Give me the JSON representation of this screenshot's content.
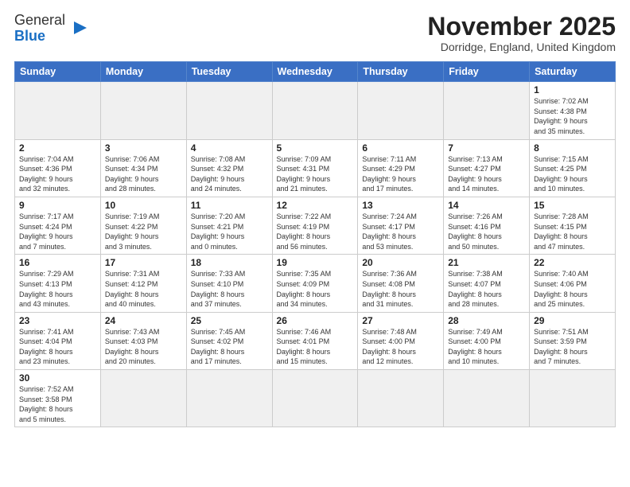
{
  "logo": {
    "line1": "General",
    "line2": "Blue"
  },
  "title": "November 2025",
  "location": "Dorridge, England, United Kingdom",
  "weekdays": [
    "Sunday",
    "Monday",
    "Tuesday",
    "Wednesday",
    "Thursday",
    "Friday",
    "Saturday"
  ],
  "weeks": [
    [
      {
        "day": "",
        "info": ""
      },
      {
        "day": "",
        "info": ""
      },
      {
        "day": "",
        "info": ""
      },
      {
        "day": "",
        "info": ""
      },
      {
        "day": "",
        "info": ""
      },
      {
        "day": "",
        "info": ""
      },
      {
        "day": "1",
        "info": "Sunrise: 7:02 AM\nSunset: 4:38 PM\nDaylight: 9 hours\nand 35 minutes."
      }
    ],
    [
      {
        "day": "2",
        "info": "Sunrise: 7:04 AM\nSunset: 4:36 PM\nDaylight: 9 hours\nand 32 minutes."
      },
      {
        "day": "3",
        "info": "Sunrise: 7:06 AM\nSunset: 4:34 PM\nDaylight: 9 hours\nand 28 minutes."
      },
      {
        "day": "4",
        "info": "Sunrise: 7:08 AM\nSunset: 4:32 PM\nDaylight: 9 hours\nand 24 minutes."
      },
      {
        "day": "5",
        "info": "Sunrise: 7:09 AM\nSunset: 4:31 PM\nDaylight: 9 hours\nand 21 minutes."
      },
      {
        "day": "6",
        "info": "Sunrise: 7:11 AM\nSunset: 4:29 PM\nDaylight: 9 hours\nand 17 minutes."
      },
      {
        "day": "7",
        "info": "Sunrise: 7:13 AM\nSunset: 4:27 PM\nDaylight: 9 hours\nand 14 minutes."
      },
      {
        "day": "8",
        "info": "Sunrise: 7:15 AM\nSunset: 4:25 PM\nDaylight: 9 hours\nand 10 minutes."
      }
    ],
    [
      {
        "day": "9",
        "info": "Sunrise: 7:17 AM\nSunset: 4:24 PM\nDaylight: 9 hours\nand 7 minutes."
      },
      {
        "day": "10",
        "info": "Sunrise: 7:19 AM\nSunset: 4:22 PM\nDaylight: 9 hours\nand 3 minutes."
      },
      {
        "day": "11",
        "info": "Sunrise: 7:20 AM\nSunset: 4:21 PM\nDaylight: 9 hours\nand 0 minutes."
      },
      {
        "day": "12",
        "info": "Sunrise: 7:22 AM\nSunset: 4:19 PM\nDaylight: 8 hours\nand 56 minutes."
      },
      {
        "day": "13",
        "info": "Sunrise: 7:24 AM\nSunset: 4:17 PM\nDaylight: 8 hours\nand 53 minutes."
      },
      {
        "day": "14",
        "info": "Sunrise: 7:26 AM\nSunset: 4:16 PM\nDaylight: 8 hours\nand 50 minutes."
      },
      {
        "day": "15",
        "info": "Sunrise: 7:28 AM\nSunset: 4:15 PM\nDaylight: 8 hours\nand 47 minutes."
      }
    ],
    [
      {
        "day": "16",
        "info": "Sunrise: 7:29 AM\nSunset: 4:13 PM\nDaylight: 8 hours\nand 43 minutes."
      },
      {
        "day": "17",
        "info": "Sunrise: 7:31 AM\nSunset: 4:12 PM\nDaylight: 8 hours\nand 40 minutes."
      },
      {
        "day": "18",
        "info": "Sunrise: 7:33 AM\nSunset: 4:10 PM\nDaylight: 8 hours\nand 37 minutes."
      },
      {
        "day": "19",
        "info": "Sunrise: 7:35 AM\nSunset: 4:09 PM\nDaylight: 8 hours\nand 34 minutes."
      },
      {
        "day": "20",
        "info": "Sunrise: 7:36 AM\nSunset: 4:08 PM\nDaylight: 8 hours\nand 31 minutes."
      },
      {
        "day": "21",
        "info": "Sunrise: 7:38 AM\nSunset: 4:07 PM\nDaylight: 8 hours\nand 28 minutes."
      },
      {
        "day": "22",
        "info": "Sunrise: 7:40 AM\nSunset: 4:06 PM\nDaylight: 8 hours\nand 25 minutes."
      }
    ],
    [
      {
        "day": "23",
        "info": "Sunrise: 7:41 AM\nSunset: 4:04 PM\nDaylight: 8 hours\nand 23 minutes."
      },
      {
        "day": "24",
        "info": "Sunrise: 7:43 AM\nSunset: 4:03 PM\nDaylight: 8 hours\nand 20 minutes."
      },
      {
        "day": "25",
        "info": "Sunrise: 7:45 AM\nSunset: 4:02 PM\nDaylight: 8 hours\nand 17 minutes."
      },
      {
        "day": "26",
        "info": "Sunrise: 7:46 AM\nSunset: 4:01 PM\nDaylight: 8 hours\nand 15 minutes."
      },
      {
        "day": "27",
        "info": "Sunrise: 7:48 AM\nSunset: 4:00 PM\nDaylight: 8 hours\nand 12 minutes."
      },
      {
        "day": "28",
        "info": "Sunrise: 7:49 AM\nSunset: 4:00 PM\nDaylight: 8 hours\nand 10 minutes."
      },
      {
        "day": "29",
        "info": "Sunrise: 7:51 AM\nSunset: 3:59 PM\nDaylight: 8 hours\nand 7 minutes."
      }
    ],
    [
      {
        "day": "30",
        "info": "Sunrise: 7:52 AM\nSunset: 3:58 PM\nDaylight: 8 hours\nand 5 minutes."
      },
      {
        "day": "",
        "info": ""
      },
      {
        "day": "",
        "info": ""
      },
      {
        "day": "",
        "info": ""
      },
      {
        "day": "",
        "info": ""
      },
      {
        "day": "",
        "info": ""
      },
      {
        "day": "",
        "info": ""
      }
    ]
  ]
}
